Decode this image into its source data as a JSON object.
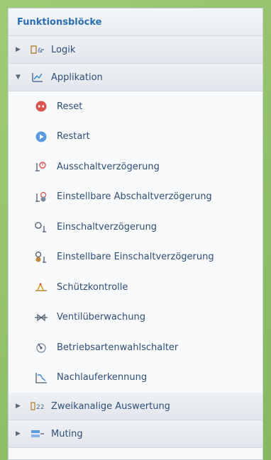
{
  "panel": {
    "title": "Funktionsblöcke"
  },
  "groups": {
    "logik": {
      "label": "Logik",
      "icon": "logic-block-icon"
    },
    "applikation": {
      "label": "Applikation",
      "icon": "application-block-icon"
    },
    "zweikanalige": {
      "label": "Zweikanalige Auswertung",
      "icon": "dual-channel-icon"
    },
    "muting": {
      "label": "Muting",
      "icon": "muting-icon"
    }
  },
  "items": [
    {
      "label": "Reset",
      "icon": "reset-icon"
    },
    {
      "label": "Restart",
      "icon": "restart-icon"
    },
    {
      "label": "Ausschaltverzögerung",
      "icon": "off-delay-icon"
    },
    {
      "label": "Einstellbare Abschaltverzögerung",
      "icon": "adjustable-off-delay-icon"
    },
    {
      "label": "Einschaltverzögerung",
      "icon": "on-delay-icon"
    },
    {
      "label": "Einstellbare Einschaltverzögerung",
      "icon": "adjustable-on-delay-icon"
    },
    {
      "label": "Schützkontrolle",
      "icon": "contactor-control-icon"
    },
    {
      "label": "Ventilüberwachung",
      "icon": "valve-monitoring-icon"
    },
    {
      "label": "Betriebsartenwahlschalter",
      "icon": "mode-selector-icon"
    },
    {
      "label": "Nachlauferkennung",
      "icon": "overrun-detection-icon"
    }
  ],
  "colors": {
    "title": "#2a6fb6",
    "text": "#2d4e78",
    "reset": "#d9534f",
    "restart": "#4a90d9",
    "background": "#8fbf6a"
  }
}
